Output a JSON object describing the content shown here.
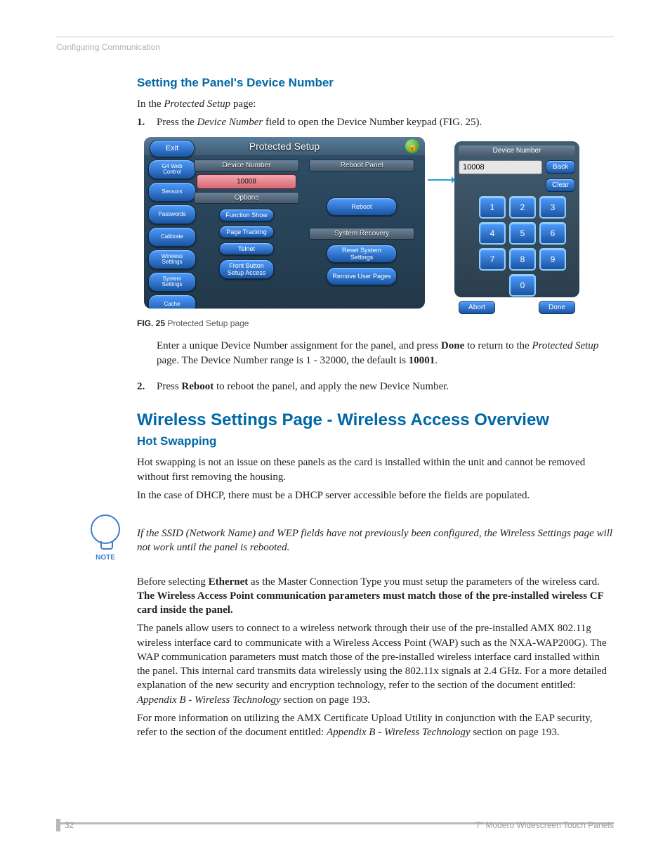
{
  "header": {
    "running": "Configuring Communication"
  },
  "h1": "Setting the Panel's Device Number",
  "intro": {
    "pre": "In the ",
    "ital": "Protected Setup",
    "post": " page:"
  },
  "steps": {
    "s1": {
      "num": "1.",
      "t1": "Press the ",
      "t2": "Device Number",
      "t3": " field to open the Device Number keypad (FIG. 25)."
    },
    "s1b": {
      "a": "Enter a unique Device Number assignment for the panel",
      "b": ", ",
      "c": "and press ",
      "done": "Done",
      "d": " to return to the ",
      "e": "Protected Setup",
      "f": " page. The Device Number range is 1 - 32000, the default is ",
      "g": "10001",
      "h": "."
    },
    "s2": {
      "num": "2.",
      "t1": "Press ",
      "t2": "Reboot",
      "t3": " to reboot the panel, and apply the new Device Number."
    }
  },
  "figcap": {
    "no": "FIG. 25",
    "txt": "  Protected Setup page"
  },
  "panel": {
    "exit": "Exit",
    "title": "Protected Setup",
    "lock": "🔒",
    "side": [
      "G4 Web Control",
      "Sensors",
      "Passwords",
      "Calibrate",
      "Wireless Settings",
      "System Settings",
      "Cache"
    ],
    "g_devnum": "Device Number",
    "dev_value": "10008",
    "g_options": "Options",
    "opts": [
      "Function Show",
      "Page Tracking",
      "Telnet",
      "Front Button Setup Access"
    ],
    "g_reboot": "Reboot Panel",
    "reboot_btn": "Reboot",
    "g_sysrec": "System Recovery",
    "rec": [
      "Reset System Settings",
      "Remove User Pages"
    ]
  },
  "keypad": {
    "title": "Device Number",
    "value": "10008",
    "back": "Back",
    "clear": "Clear",
    "keys": [
      "1",
      "2",
      "3",
      "4",
      "5",
      "6",
      "7",
      "8",
      "9"
    ],
    "zero": "0",
    "abort": "Abort",
    "done": "Done"
  },
  "h2": "Wireless Settings Page - Wireless Access Overview",
  "h3": "Hot Swapping",
  "p_hot1": "Hot swapping is not an issue on these panels as the card is installed within the unit and cannot be removed without first removing the housing.",
  "p_hot2": "In the case of DHCP, there must be a DHCP server accessible before the fields are populated.",
  "note": {
    "label": "NOTE",
    "text": "If the SSID (Network Name) and WEP fields have not previously been configured, the Wireless Settings page will not work until the panel is rebooted."
  },
  "p_eth": {
    "a": "Before selecting ",
    "b": "Ethernet",
    "c": " as the Master Connection Type you must setup the parameters of the wireless card. ",
    "d": "The Wireless Access Point communication parameters must match those of the pre-installed wireless CF card inside the panel."
  },
  "p_wap": {
    "a": "The panels allow users to connect to a wireless network through their use of the pre-installed AMX 802.11g wireless interface card to communicate with a Wireless Access Point (WAP) such as the NXA-WAP200G). The WAP communication parameters must match those of the pre-installed wireless interface card installed within the panel. This internal card transmits data wirelessly using the 802.11x signals at 2.4 GHz. For a more detailed explanation of the new security and encryption technology, refer to the section of the document entitled: ",
    "b": "Appendix B - Wireless Technology",
    "c": " section on page 193."
  },
  "p_cert": {
    "a": "For more information on utilizing the AMX Certificate Upload Utility in conjunction with the EAP security, refer to the section of the document entitled: ",
    "b": "Appendix B - Wireless Technology",
    "c": " section on page 193."
  },
  "footer": {
    "page": "32",
    "title": "7\" Modero Widescreen Touch Panels"
  }
}
